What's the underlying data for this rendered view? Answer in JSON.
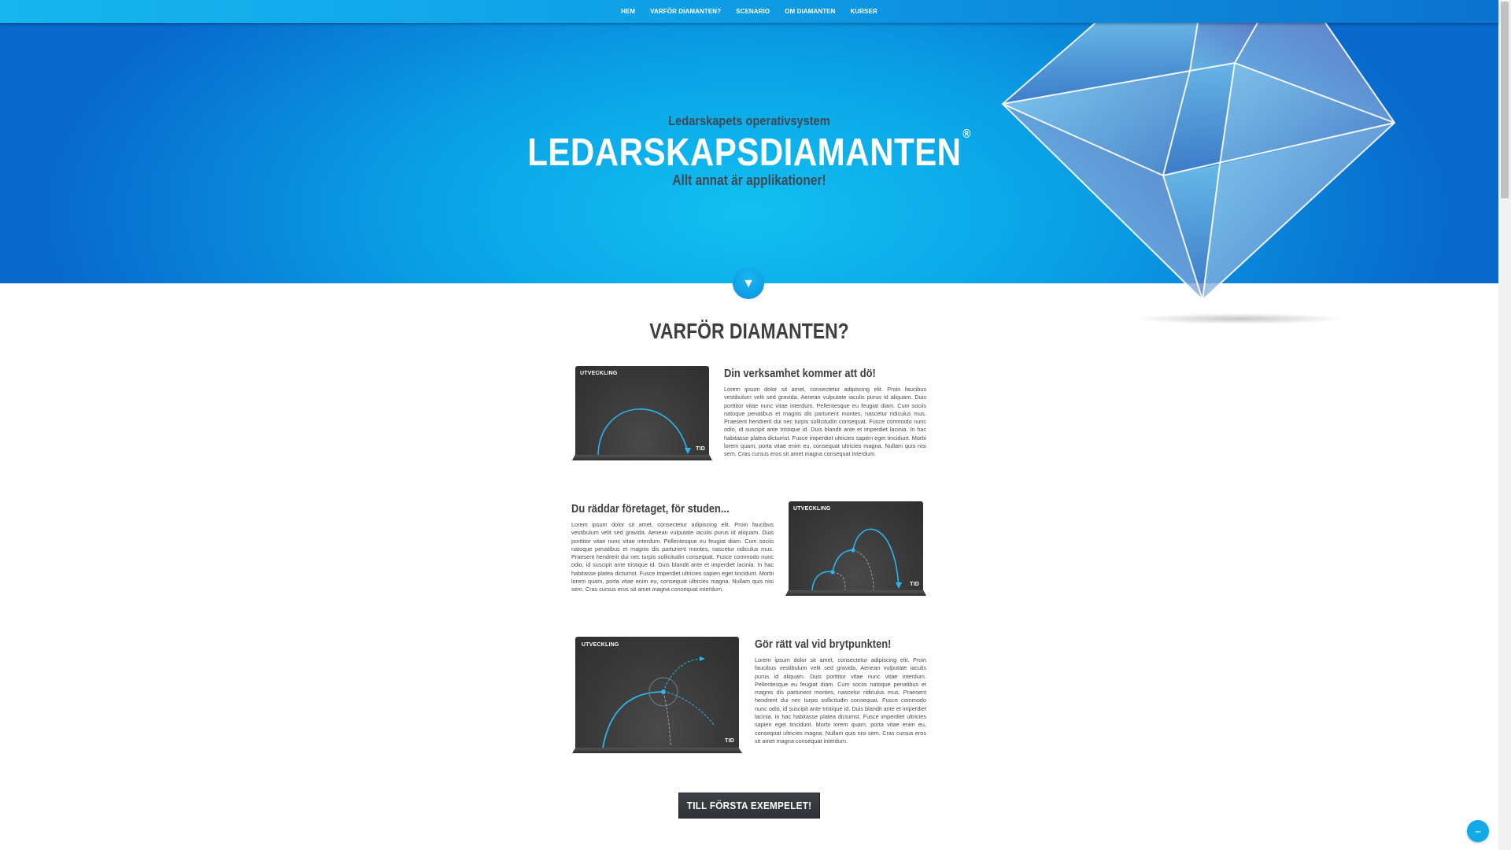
{
  "nav": {
    "items": [
      {
        "label": "HEM"
      },
      {
        "label": "VARFÖR DIAMANTEN?"
      },
      {
        "label": "SCENARIO"
      },
      {
        "label": "OM DIAMANTEN"
      },
      {
        "label": "KURSER"
      }
    ]
  },
  "hero": {
    "subtitle": "Ledarskapets operativsystem",
    "title": "LEDARSKAPSDIAMANTEN",
    "registered_mark": "®",
    "tagline": "Allt annat är applikationer!",
    "scroll_icon": "triangle-down-icon"
  },
  "section": {
    "title": "VARFÖR DIAMANTEN?"
  },
  "features": [
    {
      "title": "Din verksamhet kommer att dö!",
      "chart_y_label": "UTVECKLING",
      "chart_x_label": "TID",
      "body": "Lorem ipsum dolor sit amet, consectetur adipiscing elit. Proin faucibus vestibulum velit sed gravida. Aenean vulputate iaculis purus id aliquam. Duis porttitor vitae nunc vitae interdum. Pellentesque eu feugiat diam. Cum sociis natoque penatibus et magnis dis parturient montes, nascetur ridiculus mus. Praesent hendrerit dui nec turpis sollicitudin consequat. Fusce commodo nunc odio, id suscipit ante tristique id. Duis blandit ante et imperdiet lacinia. In hac habitasse platea dictumst. Fusce imperdiet ultricies sapien eget tincidunt. Morbi lorem quam, porta vitae enim eu, consequat ultricies magna. Nullam quis nisi sem. Cras cursus eros sit amet magna consequat interdum."
    },
    {
      "title": "Du räddar företaget, för studen...",
      "chart_y_label": "UTVECKLING",
      "chart_x_label": "TID",
      "body": "Lorem ipsum dolor sit amet, consectetur adipiscing elit. Proin faucibus vestibulum velit sed gravida. Aenean vulputate iaculis purus id aliquam. Duis porttitor vitae nunc vitae interdum. Pellentesque eu feugiat diam. Cum sociis natoque penatibus et magnis dis parturient montes, nascetur ridiculus mus. Praesent hendrerit dui nec turpis sollicitudin consequat. Fusce commodo nunc odio, id suscipit ante tristique id. Duis blandit ante et imperdiet lacinia. In hac habitasse platea dictumst. Fusce imperdiet ultricies sapien eget tincidunt. Morbi lorem quam, porta vitae enim eu, consequat ultricies magna. Nullam quis nisi sem. Cras cursus eros sit amet magna consequat interdum."
    },
    {
      "title": "Gör rätt val vid brytpunkten!",
      "chart_y_label": "UTVECKLING",
      "chart_x_label": "TID",
      "body": "Lorem ipsum dolor sit amet, consectetur adipiscing elit. Proin faucibus vestibulum velit sed gravida. Aenean vulputate iaculis purus id aliquam. Duis porttitor vitae nunc vitae interdum. Pellentesque eu feugiat diam. Cum sociis natoque penatibus et magnis dis parturient montes, nascetur ridiculus mus. Praesent hendrerit dui nec turpis sollicitudin consequat. Fusce commodo nunc odio, id suscipit ante tristique id. Duis blandit ante et imperdiet lacinia. In hac habitasse platea dictumst. Fusce imperdiet ultricies sapien eget tincidunt. Morbi lorem quam, porta vitae enim eu, consequat ultricies magna. Nullam quis nisi sem. Cras cursus eros sit amet magna consequat interdum."
    }
  ],
  "cta": {
    "label": "TILL FÖRSTA EXEMPELET!"
  },
  "colors": {
    "brand_blue": "#0a9fe6",
    "accent_cyan": "#29b6ef",
    "dark_text": "#3f3f3f"
  }
}
